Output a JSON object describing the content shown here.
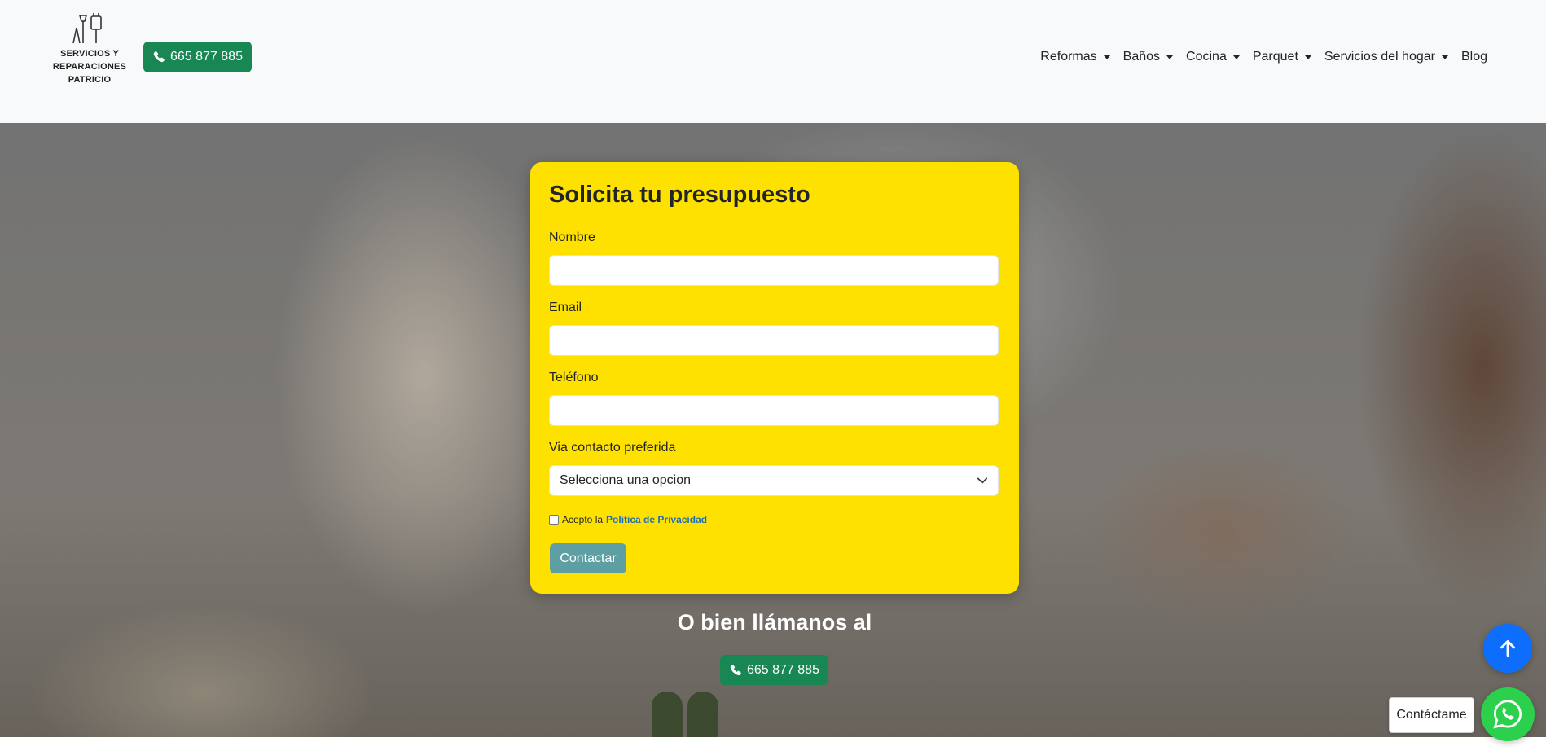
{
  "header": {
    "logo_text": "SERVICIOS Y\nREPARACIONES\nPATRICIO",
    "phone_label": "665 877 885",
    "nav": [
      {
        "label": "Reformas",
        "dropdown": true
      },
      {
        "label": "Baños",
        "dropdown": true
      },
      {
        "label": "Cocina",
        "dropdown": true
      },
      {
        "label": "Parquet",
        "dropdown": true
      },
      {
        "label": "Servicios del hogar",
        "dropdown": true
      },
      {
        "label": "Blog",
        "dropdown": false
      }
    ]
  },
  "form": {
    "title": "Solicita tu presupuesto",
    "name_label": "Nombre",
    "email_label": "Email",
    "phone_label": "Teléfono",
    "contact_via_label": "Via contacto preferida",
    "contact_via_selected": "Selecciona una opcion",
    "accept_prefix": "Acepto la",
    "privacy_link": "Politica de Privacidad",
    "submit_label": "Contactar"
  },
  "call": {
    "title": "O bien llámanos al",
    "phone_label": "665 877 885"
  },
  "floating": {
    "contact_label": "Contáctame"
  },
  "colors": {
    "card_bg": "#ffe100",
    "phone_button": "#198754",
    "submit_button": "#5e9fa3",
    "scroll_top": "#0d6efd",
    "whatsapp": "#2bd14d"
  }
}
